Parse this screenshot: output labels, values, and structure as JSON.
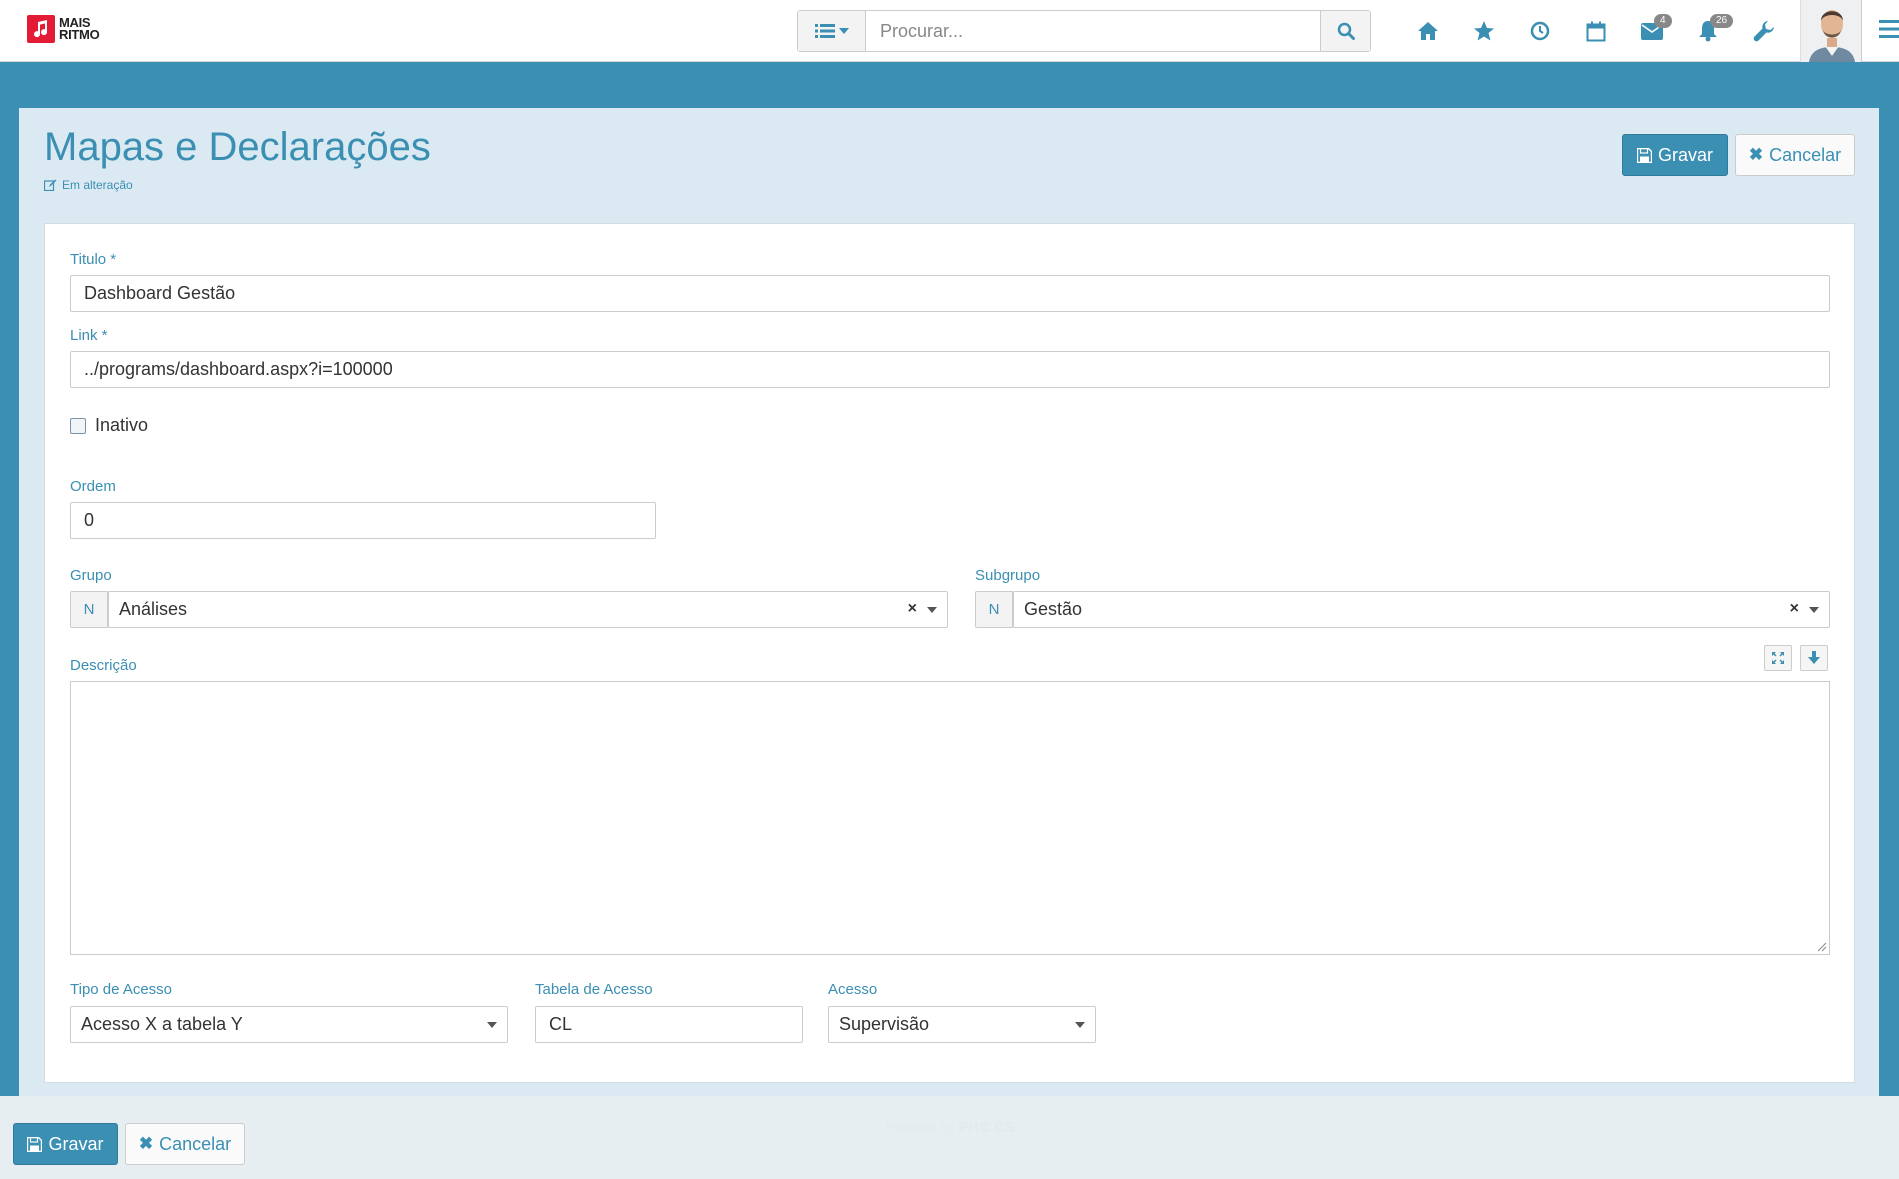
{
  "brand": {
    "line1": "MAIS",
    "line2": "RITMO"
  },
  "search": {
    "placeholder": "Procurar..."
  },
  "nav": {
    "icons": [
      "home-icon",
      "star-icon",
      "clock-icon",
      "calendar-icon",
      "envelope-icon",
      "bell-icon",
      "wrench-icon"
    ],
    "messages_badge": "4",
    "notifications_badge": "26"
  },
  "page": {
    "title": "Mapas e Declarações",
    "status": "Em alteração"
  },
  "actions": {
    "save": "Gravar",
    "cancel": "Cancelar"
  },
  "form": {
    "titulo": {
      "label": "Titulo *",
      "value": "Dashboard Gestão"
    },
    "link": {
      "label": "Link *",
      "value": "../programs/dashboard.aspx?i=100000"
    },
    "inativo": {
      "label": "Inativo",
      "checked": false
    },
    "ordem": {
      "label": "Ordem",
      "value": "0"
    },
    "grupo": {
      "label": "Grupo",
      "addon": "N",
      "value": "Análises"
    },
    "subgrupo": {
      "label": "Subgrupo",
      "addon": "N",
      "value": "Gestão"
    },
    "descricao": {
      "label": "Descrição",
      "value": ""
    },
    "tipo_acesso": {
      "label": "Tipo de Acesso",
      "value": "Acesso X a tabela Y"
    },
    "tabela_acesso": {
      "label": "Tabela de Acesso",
      "value": "CL"
    },
    "acesso": {
      "label": "Acesso",
      "value": "Supervisão"
    }
  },
  "footer": {
    "powered_by": "Powered by",
    "product": "PHC CS"
  },
  "colors": {
    "accent": "#3a8fb3",
    "panel": "#dbeaf2",
    "logo": "#e31b35"
  }
}
